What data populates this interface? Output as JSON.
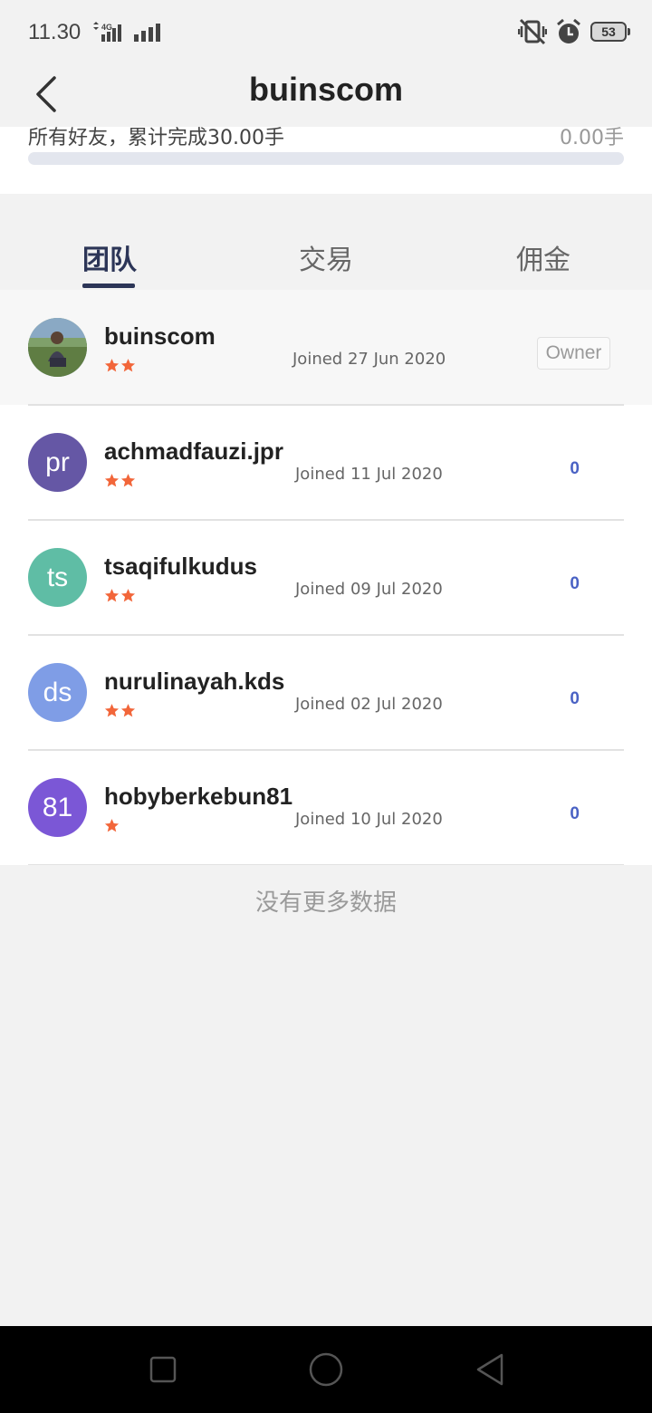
{
  "status_bar": {
    "time": "11.30",
    "battery": "53",
    "icons": [
      "signal-4g-icon",
      "signal-icon",
      "vibrate-off-icon",
      "alarm-icon",
      "battery-icon"
    ]
  },
  "header": {
    "title": "buinscom",
    "back_icon": "chevron-left-icon"
  },
  "summary": {
    "text": "所有好友，累计完成30.00手",
    "value": "0.00手",
    "progress_percent": 0
  },
  "tabs": [
    {
      "label": "团队",
      "active": true
    },
    {
      "label": "交易",
      "active": false
    },
    {
      "label": "佣金",
      "active": false
    }
  ],
  "members": [
    {
      "name": "buinscom",
      "joined": "Joined 27 Jun 2020",
      "stars": 2,
      "badge": "Owner",
      "avatar_text": "",
      "avatar_color": "#6b8a5a",
      "is_owner": true
    },
    {
      "name": "achmadfauzi.jpr",
      "joined": "Joined 11 Jul 2020",
      "stars": 2,
      "count": "0",
      "avatar_text": "pr",
      "avatar_color": "#6557a5"
    },
    {
      "name": "tsaqifulkudus",
      "joined": "Joined 09 Jul 2020",
      "stars": 2,
      "count": "0",
      "avatar_text": "ts",
      "avatar_color": "#5fbda5"
    },
    {
      "name": "nurulinayah.kds",
      "joined": "Joined 02 Jul 2020",
      "stars": 2,
      "count": "0",
      "avatar_text": "ds",
      "avatar_color": "#7f9de6"
    },
    {
      "name": "hobyberkebun81",
      "joined": "Joined 10 Jul 2020",
      "stars": 1,
      "count": "0",
      "avatar_text": "81",
      "avatar_color": "#7b57d6"
    }
  ],
  "footer_text": "没有更多数据",
  "colors": {
    "accent": "#2c3557",
    "count": "#4a62c4",
    "star": "#f2663a"
  },
  "navbar": {
    "icons": [
      "recents-square-icon",
      "home-circle-icon",
      "back-triangle-icon"
    ]
  }
}
